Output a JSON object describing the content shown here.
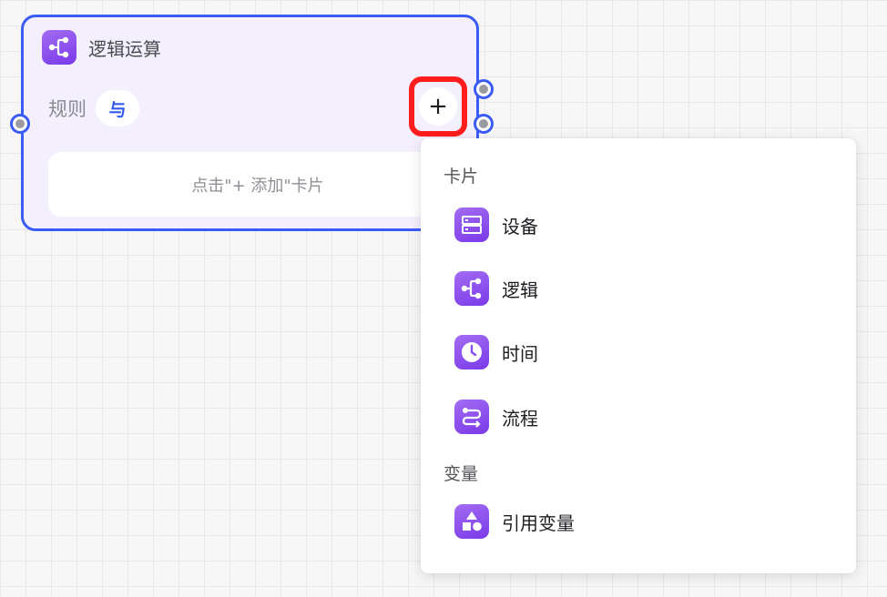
{
  "node": {
    "icon": "logic-branch-icon",
    "title": "逻辑运算",
    "rule_label": "规则",
    "rule_value": "与",
    "placeholder": "点击\"+ 添加\"卡片",
    "add_button_label": "+"
  },
  "menu": {
    "sections": [
      {
        "title": "卡片",
        "items": [
          {
            "label": "设备",
            "icon": "device-icon"
          },
          {
            "label": "逻辑",
            "icon": "logic-branch-icon"
          },
          {
            "label": "时间",
            "icon": "clock-icon"
          },
          {
            "label": "流程",
            "icon": "flow-icon"
          }
        ]
      },
      {
        "title": "变量",
        "items": [
          {
            "label": "引用变量",
            "icon": "shapes-icon"
          }
        ]
      }
    ]
  },
  "colors": {
    "accent": "#3b5bf5",
    "icon_purple": "#8b4cf0",
    "highlight_red": "#ff1d1d",
    "node_bg": "#f4effd"
  }
}
